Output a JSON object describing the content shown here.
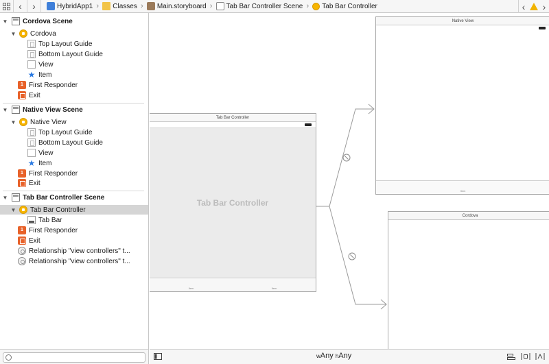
{
  "jumpbar": {
    "nav_back": "‹",
    "nav_forward": "›",
    "crumbs": [
      {
        "label": "HybridApp1",
        "icon": "project-icon"
      },
      {
        "label": "Classes",
        "icon": "folder-icon"
      },
      {
        "label": "Main.storyboard",
        "icon": "storyboard-icon"
      },
      {
        "label": "Tab Bar Controller Scene",
        "icon": "scene-icon"
      },
      {
        "label": "Tab Bar Controller",
        "icon": "view-controller-icon"
      }
    ],
    "right_back": "‹",
    "right_forward": "›"
  },
  "outline": {
    "scenes": [
      {
        "title": "Cordova Scene",
        "controller": "Cordova",
        "children": [
          "Top Layout Guide",
          "Bottom Layout Guide",
          "View",
          "Item"
        ],
        "first_responder": "First Responder",
        "exit": "Exit"
      },
      {
        "title": "Native View Scene",
        "controller": "Native View",
        "children": [
          "Top Layout Guide",
          "Bottom Layout Guide",
          "View",
          "Item"
        ],
        "first_responder": "First Responder",
        "exit": "Exit"
      },
      {
        "title": "Tab Bar Controller Scene",
        "controller": "Tab Bar Controller",
        "children": [
          "Tab Bar"
        ],
        "first_responder": "First Responder",
        "exit": "Exit",
        "relationships": [
          "Relationship \"view controllers\" t...",
          "Relationship \"view controllers\" t..."
        ]
      }
    ]
  },
  "canvas": {
    "tab_bar_controller": {
      "title": "Tab Bar Controller",
      "center_label": "Tab Bar Controller",
      "tabs": [
        "Item",
        "Item"
      ]
    },
    "native_view": {
      "title": "Native View",
      "tab": "Item"
    },
    "cordova": {
      "title": "Cordova"
    }
  },
  "bottom": {
    "w_prefix": "w",
    "w_value": "Any",
    "h_prefix": "h",
    "h_value": "Any"
  },
  "colors": {
    "selection": "#d5d5d5",
    "segue_line": "#9b9b9b",
    "warning": "#f1b300"
  }
}
